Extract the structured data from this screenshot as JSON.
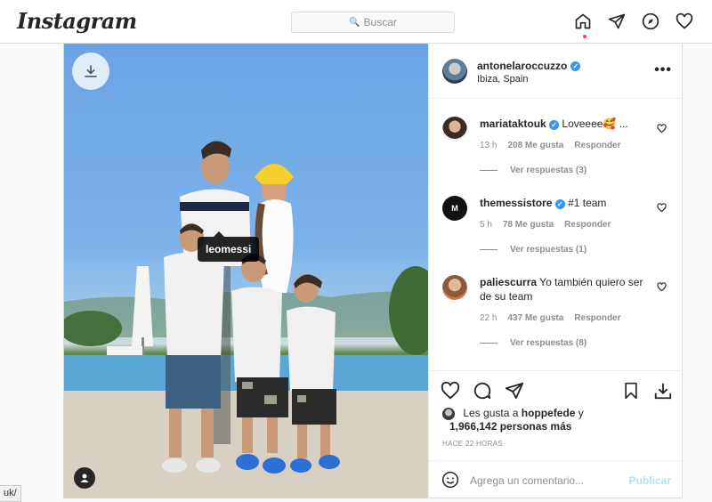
{
  "nav": {
    "logo": "Instagram",
    "search_placeholder": "Buscar",
    "icons": [
      "home-icon",
      "direct-icon",
      "explore-icon",
      "activity-heart-icon"
    ]
  },
  "post": {
    "author": "antonelaroccuzzo",
    "location": "Ibiza, Spain",
    "photo_tag": "leomessi",
    "more_label": "•••"
  },
  "comments": [
    {
      "user": "mariataktouk",
      "text": "Loveeee🥰 ...",
      "time": "13 h",
      "likes": "208 Me gusta",
      "reply": "Responder",
      "replies": "Ver respuestas (3)",
      "verified": true
    },
    {
      "user": "themessistore",
      "text": "#1 team",
      "time": "5 h",
      "likes": "78 Me gusta",
      "reply": "Responder",
      "replies": "Ver respuestas (1)",
      "verified": true
    },
    {
      "user": "paliescurra",
      "text": "Yo también quiero ser de su team",
      "time": "22 h",
      "likes": "437 Me gusta",
      "reply": "Responder",
      "replies": "Ver respuestas (8)",
      "verified": false
    }
  ],
  "likes": {
    "prefix": "Les gusta a",
    "user": "hoppefede",
    "conj": "y",
    "count": "1,966,142 personas más"
  },
  "time_ago": "HACE 22 HORAS",
  "add_comment": {
    "placeholder": "Agrega un comentario...",
    "publish": "Publicar"
  },
  "status_url": "uk/",
  "colors": {
    "accent": "#3897f0",
    "like_red": "#ed4956",
    "publish_disabled": "#b2dffc"
  }
}
